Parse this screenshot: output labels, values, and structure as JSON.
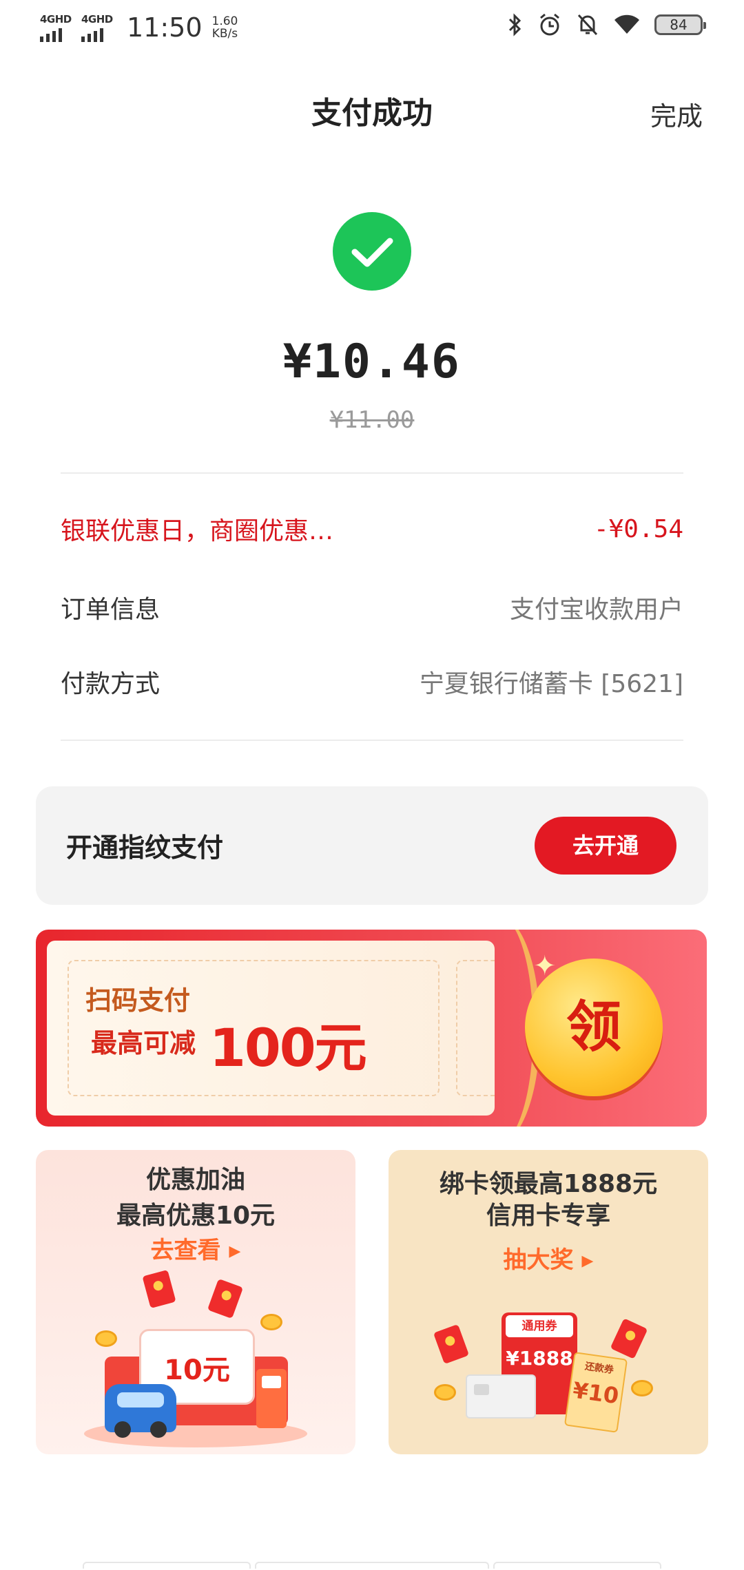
{
  "status_bar": {
    "signal1": "4GHD",
    "signal2": "4GHD",
    "time": "11:50",
    "speed_value": "1.60",
    "speed_unit": "KB/s",
    "battery": "84",
    "icons": [
      "bluetooth-icon",
      "alarm-icon",
      "mute-icon",
      "wifi-icon",
      "battery-icon"
    ]
  },
  "header": {
    "title": "支付成功",
    "done_label": "完成"
  },
  "payment": {
    "amount": "¥10.46",
    "original_amount": "¥11.00"
  },
  "details": {
    "discount_label": "银联优惠日，商圈优惠…",
    "discount_value": "-¥0.54",
    "order_label": "订单信息",
    "order_value": "支付宝收款用户",
    "method_label": "付款方式",
    "method_value": "宁夏银行储蓄卡 [5621]"
  },
  "fingerprint": {
    "label": "开通指纹支付",
    "button": "去开通"
  },
  "banner": {
    "line1": "扫码支付",
    "line2": "最高可减",
    "highlight": "100元",
    "coin_text": "领"
  },
  "card_left": {
    "title1": "优惠加油",
    "title2": "最高优惠10元",
    "cta": "去查看 ▸",
    "pad_value": "10元"
  },
  "card_right": {
    "title1": "绑卡领最高1888元",
    "title2": "信用卡专享",
    "cta": "抽大奖 ▸",
    "coupon_head": "通用券",
    "coupon_amount": "¥1888",
    "voucher_head": "还款券",
    "voucher_amount": "¥10"
  },
  "colors": {
    "success_green": "#1dc558",
    "accent_red": "#e31923",
    "discount_red": "#d7151d"
  }
}
